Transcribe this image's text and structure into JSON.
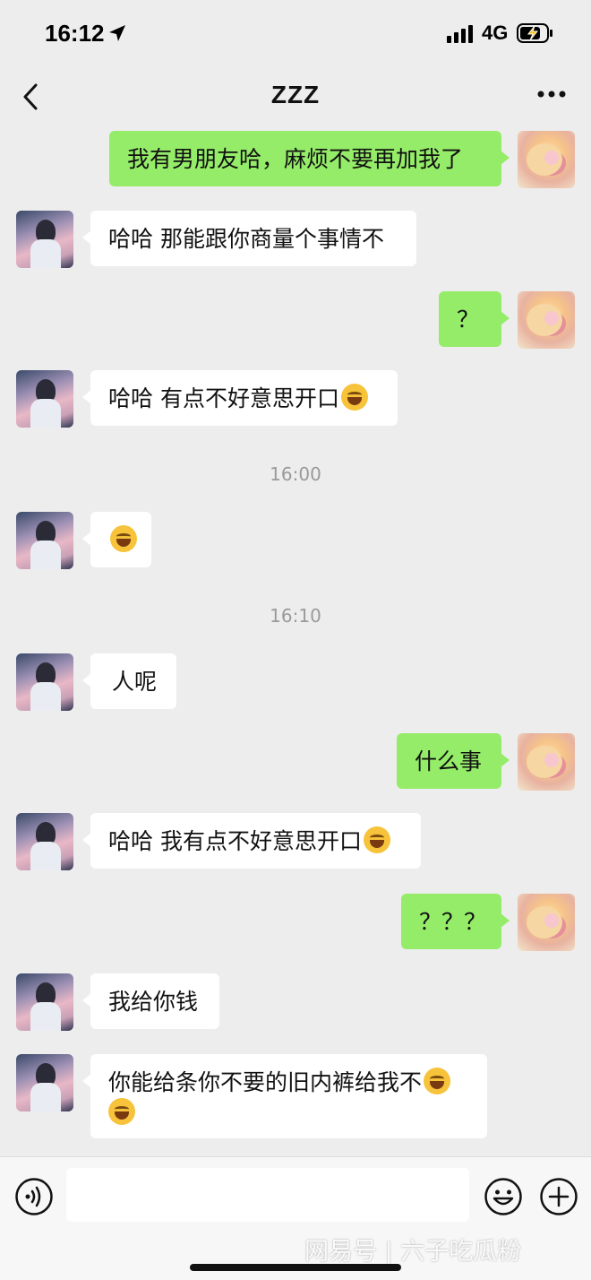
{
  "status_bar": {
    "time": "16:12",
    "network": "4G"
  },
  "nav": {
    "title": "ZZZ",
    "icons": [
      "back-icon",
      "more-icon"
    ]
  },
  "messages": [
    {
      "from": "me",
      "text": "我有男朋友哈，麻烦不要再加我了"
    },
    {
      "from": "them",
      "text": "哈哈 那能跟你商量个事情不"
    },
    {
      "from": "me",
      "text": "？"
    },
    {
      "from": "them",
      "text": "哈哈 有点不好意思开口",
      "emoji": "laughing-crying-emoji"
    },
    {
      "timestamp": "16:00"
    },
    {
      "from": "them",
      "text": "",
      "emoji": "laughing-crying-emoji"
    },
    {
      "timestamp": "16:10"
    },
    {
      "from": "them",
      "text": "人呢"
    },
    {
      "from": "me",
      "text": "什么事"
    },
    {
      "from": "them",
      "text": "哈哈 我有点不好意思开口",
      "emoji": "laughing-crying-emoji"
    },
    {
      "from": "me",
      "text": "？？？"
    },
    {
      "from": "them",
      "text": "我给你钱"
    },
    {
      "from": "them",
      "text": "你能给条你不要的旧内裤给我不",
      "emoji": "laughing-crying-emoji",
      "emoji_count": 2
    }
  ],
  "input_bar": {
    "placeholder": "",
    "icons": [
      "voice-icon",
      "emoji-icon",
      "plus-icon"
    ]
  },
  "watermark": "网易号 | 六子吃瓜粉",
  "colors": {
    "background": "#ededed",
    "my_bubble": "#95ec69",
    "their_bubble": "#ffffff"
  }
}
